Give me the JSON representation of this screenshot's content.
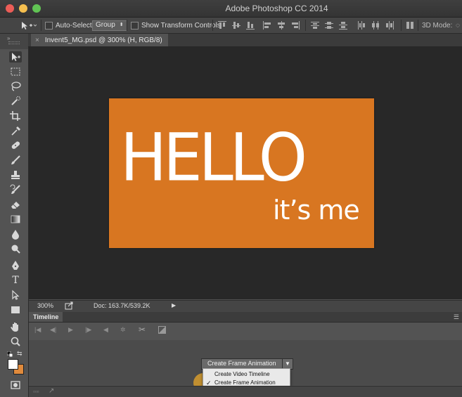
{
  "app": {
    "title": "Adobe Photoshop CC 2014"
  },
  "options_bar": {
    "auto_select_label": "Auto-Select:",
    "auto_select_value": "Group",
    "show_transform_label": "Show Transform Controls",
    "mode_3d_label": "3D Mode:"
  },
  "document": {
    "tab_title": "Invent5_MG.psd @ 300% (H, RGB/8)",
    "close_glyph": "×"
  },
  "artwork": {
    "headline": "HELLO",
    "subline": "it’s me",
    "background_color": "#d87621",
    "text_color": "#ffffff"
  },
  "status_bar": {
    "zoom": "300%",
    "doc_info": "Doc: 163.7K/539.2K"
  },
  "timeline": {
    "tab_label": "Timeline",
    "create_button_label": "Create Frame Animation",
    "dropdown_options": [
      {
        "label": "Create Video Timeline",
        "checked": false
      },
      {
        "label": "Create Frame Animation",
        "checked": true
      }
    ],
    "check_glyph": "✓"
  },
  "tools": [
    "move-tool",
    "marquee-tool",
    "lasso-tool",
    "quick-selection-tool",
    "crop-tool",
    "eyedropper-tool",
    "spot-healing-tool",
    "brush-tool",
    "clone-stamp-tool",
    "history-brush-tool",
    "eraser-tool",
    "gradient-tool",
    "blur-tool",
    "dodge-tool",
    "pen-tool",
    "type-tool",
    "path-selection-tool",
    "rectangle-tool",
    "hand-tool",
    "zoom-tool"
  ],
  "colors": {
    "foreground": "#ffffff",
    "background": "#e08a3c",
    "ui_dark": "#282828",
    "ui_panel": "#535353"
  }
}
